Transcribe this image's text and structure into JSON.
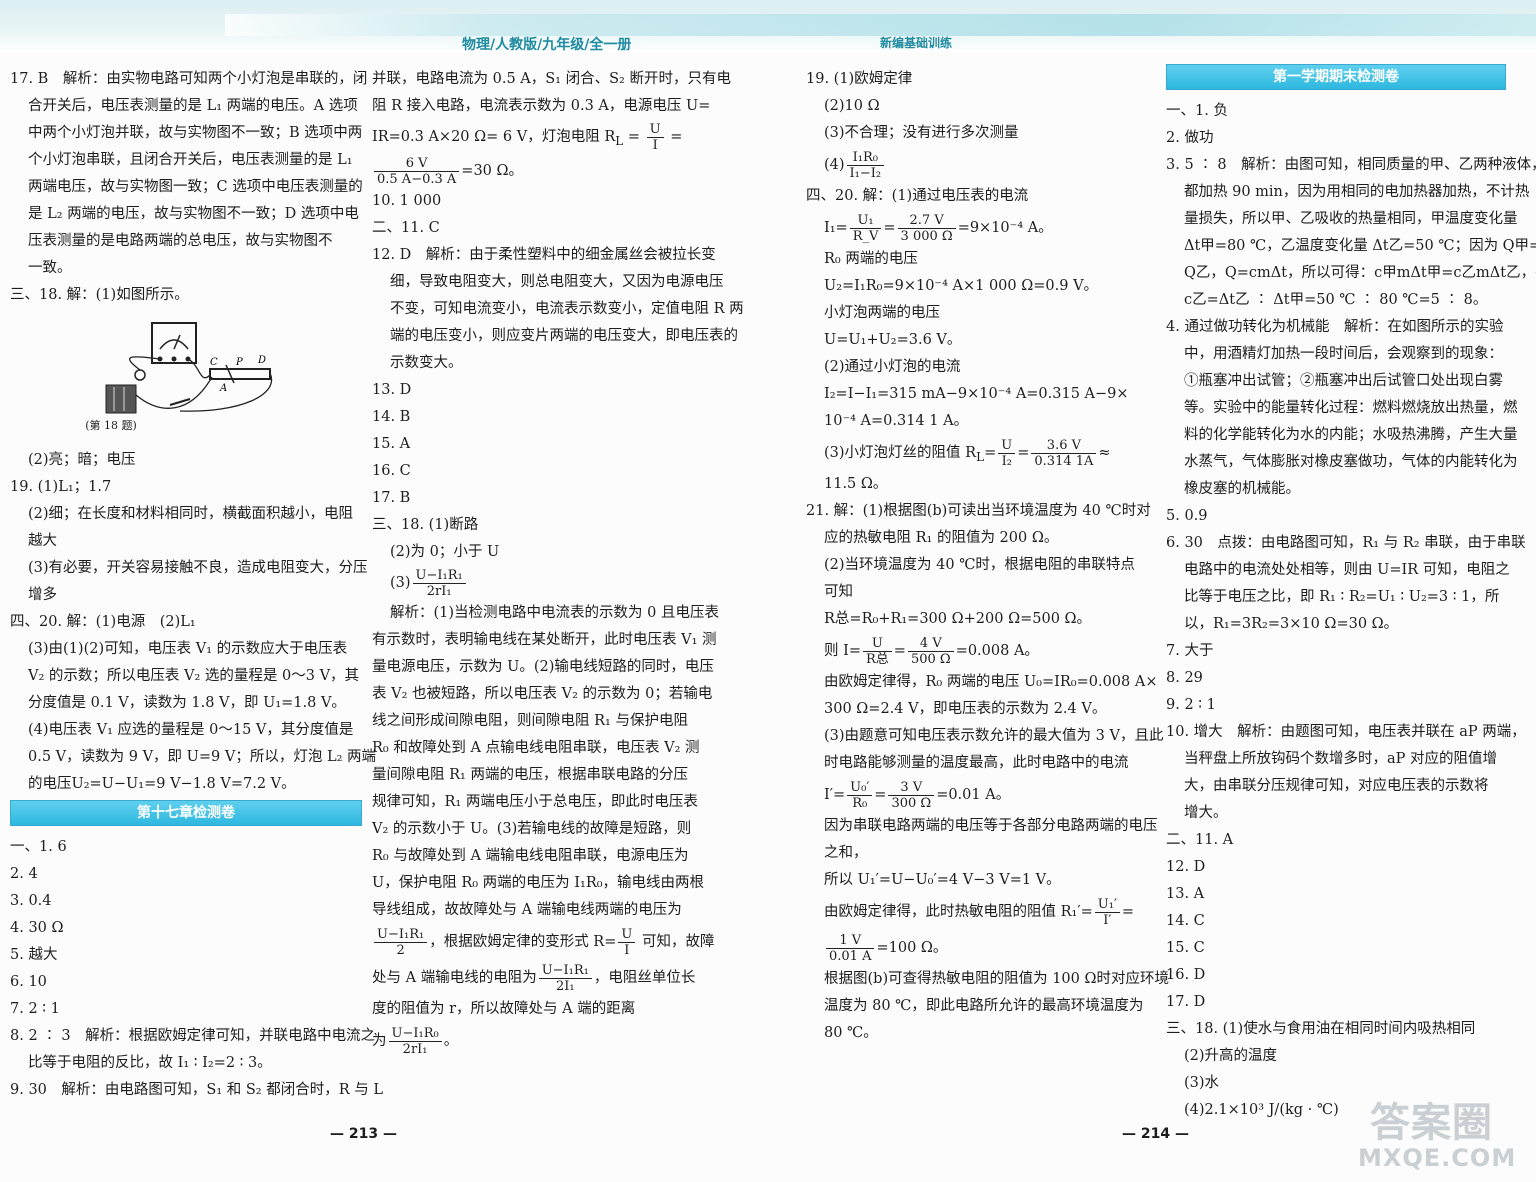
{
  "header": {
    "left": "物理/人教版/九年级/全一册",
    "right": "新编基础训练"
  },
  "col1": {
    "lines": [
      "17. B　解析：由实物电路可知两个小灯泡是串联的，闭",
      "合开关后，电压表测量的是 L₁ 两端的电压。A 选项",
      "中两个小灯泡并联，故与实物图不一致；B 选项中两",
      "个小灯泡串联，且闭合开关后，电压表测量的是 L₁",
      "两端电压，故与实物图一致；C 选项中电压表测量的",
      "是 L₂ 两端的电压，故与实物图不一致；D 选项中电",
      "压表测量的是电路两端的总电压，故与实物图不",
      "一致。",
      "三、18. 解：(1)如图所示。"
    ],
    "fig_caption": "(第 18 题)",
    "fig_labels": [
      "C",
      "P",
      "D",
      "A"
    ],
    "lines2": [
      "(2)亮；暗；电压",
      "19. (1)L₁；1.7",
      "(2)细；在长度和材料相同时，横截面积越小，电阻",
      "越大",
      "(3)有必要，开关容易接触不良，造成电阻变大，分压",
      "增多",
      "四、20. 解：(1)电源　(2)L₁",
      "(3)由(1)(2)可知，电压表 V₁ 的示数应大于电压表",
      "V₂ 的示数；所以电压表 V₂ 选的量程是 0～3 V，其",
      "分度值是 0.1 V，读数为 1.8 V，即 U₁=1.8 V。",
      "(4)电压表 V₁ 应选的量程是 0～15 V，其分度值是",
      "0.5 V，读数为 9 V，即 U=9 V；所以，灯泡 L₂ 两端",
      "的电压U₂=U−U₁=9 V−1.8 V=7.2 V。"
    ],
    "banner": "第十七章检测卷",
    "lines3": [
      "一、1. 6",
      "2. 4",
      "3. 0.4",
      "4. 30 Ω",
      "5. 越大",
      "6. 10",
      "7. 2 ∶ 1",
      "8. 2 ∶ 3　解析：根据欧姆定律可知，并联电路中电流之",
      "比等于电阻的反比，故 I₁ ∶ I₂=2 ∶ 3。",
      "9. 30　解析：由电路图可知，S₁ 和 S₂ 都闭合时，R 与 L"
    ],
    "page": "— 213 —"
  },
  "col2": {
    "l1": "并联，电路电流为 0.5 A，S₁ 闭合、S₂ 断开时，只有电",
    "l2": "阻 R 接入电路，电流表示数为 0.3 A，电源电压 U=",
    "l3a": "IR=0.3 A×20 Ω= 6 V，灯泡电阻 R",
    "l3sub": "L",
    "l3b": " =",
    "f1n": "U",
    "f1d": "I",
    "l3c": " =",
    "f2n": "6 V",
    "f2d": "0.5 A−0.3 A",
    "l4b": "=30 Ω。",
    "lines": [
      "10. 1 000",
      "二、11. C",
      "12. D　解析：由于柔性塑料中的细金属丝会被拉长变",
      "细，导致电阻变大，则总电阻变大，又因为电源电压",
      "不变，可知电流变小，电流表示数变小，定值电阻 R 两",
      "端的电压变小，则应变片两端的电压变大，即电压表的",
      "示数变大。",
      "13. D",
      "14. B",
      "15. A",
      "16. C",
      "17. B",
      "三、18. (1)断路",
      "(2)为 0；小于 U"
    ],
    "f3n": "U−I₁R₁",
    "f3d": "2rI₁",
    "lines2": [
      "解析：(1)当检测电路中电流表的示数为 0 且电压表",
      "有示数时，表明输电线在某处断开，此时电压表 V₁ 测",
      "量电源电压，示数为 U。(2)输电线短路的同时，电压",
      "表 V₂ 也被短路，所以电压表 V₂ 的示数为 0；若输电",
      "线之间形成间隙电阻，则间隙电阻 R₁ 与保护电阻",
      "R₀ 和故障处到 A 点输电线电阻串联，电压表 V₂ 测",
      "量间隙电阻 R₁ 两端的电压，根据串联电路的分压",
      "规律可知，R₁ 两端电压小于总电压，即此时电压表",
      "V₂ 的示数小于 U。(3)若输电线的故障是短路，则",
      "R₀ 与故障处到 A 端输电线电阻串联，电源电压为",
      "U，保护电阻 R₀ 两端的电压为 I₁R₀，输电线由两根",
      "导线组成，故故障处与 A 端输电线两端的电压为"
    ],
    "f4n": "U−I₁R₁",
    "f4d": "2",
    "l5a": "，根据欧姆定律的变形式 R=",
    "f5n": "U",
    "f5d": "I",
    "l5b": " 可知，故障",
    "l6a": "处与 A 端输电线的电阻为",
    "f6n": "U−I₁R₁",
    "f6d": "2I₁",
    "l6b": "，电阻丝单位长",
    "l7": "度的阻值为 r，所以故障处与 A 端的距离",
    "l8a": "为",
    "f7n": "U−I₁R₀",
    "f7d": "2rI₁",
    "l8b": "。"
  },
  "col3": {
    "lines": [
      "19. (1)欧姆定律",
      "(2)10 Ω",
      "(3)不合理；没有进行多次测量"
    ],
    "f1n": "I₁R₀",
    "f1d": "I₁−I₂",
    "l4": "(4)",
    "l5": "四、20. 解：(1)通过电压表的电流",
    "l6a": "I₁=",
    "f2n": "U₁",
    "f2d": "R_V",
    "f3n": "2.7 V",
    "f3d": "3 000 Ω",
    "l6b": "=9×10⁻⁴ A。",
    "lines2": [
      "R₀ 两端的电压",
      "U₂=I₁R₀=9×10⁻⁴ A×1 000 Ω=0.9 V。",
      "小灯泡两端的电压",
      "U=U₁+U₂=3.6 V。",
      "(2)通过小灯泡的电流",
      "I₂=I−I₁=315 mA−9×10⁻⁴ A=0.315 A−9×",
      "10⁻⁴ A=0.314 1 A。"
    ],
    "l7a": "(3)小灯泡灯丝的阻值 R",
    "l7sub": "L",
    "f4n": "U",
    "f4d": "I₂",
    "f5n": "3.6 V",
    "f5d": "0.314 1A",
    "l7b": "≈",
    "lines3": [
      "11.5 Ω。",
      "21. 解：(1)根据图(b)可读出当环境温度为 40 ℃时对",
      "应的热敏电阻 R₁ 的阻值为 200 Ω。",
      "(2)当环境温度为 40 ℃时，根据电阻的串联特点",
      "可知",
      "R总=R₀+R₁=300 Ω+200 Ω=500 Ω。"
    ],
    "l8a": "则 I=",
    "f6n": "U",
    "f6d": "R总",
    "f7n": "4 V",
    "f7d": "500 Ω",
    "l8b": "=0.008 A。",
    "lines4": [
      "由欧姆定律得，R₀ 两端的电压 U₀=IR₀=0.008 A×",
      "300 Ω=2.4 V，即电压表的示数为 2.4 V。",
      "(3)由题意可知电压表示数允许的最大值为 3 V，且此",
      "时电路能够测量的温度最高，此时电路中的电流"
    ],
    "l9a": "I′=",
    "f8n": "U₀′",
    "f8d": "R₀",
    "f9n": "3 V",
    "f9d": "300 Ω",
    "l9b": "=0.01 A。",
    "lines5": [
      "因为串联电路两端的电压等于各部分电路两端的电压",
      "之和，",
      "所以 U₁′=U−U₀′=4 V−3 V=1 V。"
    ],
    "l10a": "由欧姆定律得，此时热敏电阻的阻值 R₁′=",
    "f10n": "U₁′",
    "f10d": "I′",
    "l10b": "=",
    "f11n": "1 V",
    "f11d": "0.01 A",
    "l11b": "=100 Ω。",
    "lines6": [
      "根据图(b)可查得热敏电阻的阻值为 100 Ω时对应环境",
      "温度为 80 ℃，即此电路所允许的最高环境温度为",
      "80 ℃。"
    ]
  },
  "col4": {
    "banner": "第一学期期末检测卷",
    "lines": [
      "一、1. 负",
      "2. 做功",
      "3. 5 ∶ 8　解析：由图可知，相同质量的甲、乙两种液体，",
      "都加热 90 min，因为用相同的电加热器加热，不计热",
      "量损失，所以甲、乙吸收的热量相同，甲温度变化量",
      "Δt甲=80 ℃，乙温度变化量 Δt乙=50 ℃；因为 Q甲=",
      "Q乙，Q=cmΔt，所以可得：c甲mΔt甲=c乙mΔt乙，c甲 ∶",
      "c乙=Δt乙 ∶ Δt甲=50 ℃ ∶ 80 ℃=5 ∶ 8。",
      "4. 通过做功转化为机械能　解析：在如图所示的实验",
      "中，用酒精灯加热一段时间后，会观察到的现象：",
      "①瓶塞冲出试管；②瓶塞冲出后试管口处出现白雾",
      "等。实验中的能量转化过程：燃料燃烧放出热量，燃",
      "料的化学能转化为水的内能；水吸热沸腾，产生大量",
      "水蒸气，气体膨胀对橡皮塞做功，气体的内能转化为",
      "橡皮塞的机械能。",
      "5. 0.9",
      "6. 30　点拨：由电路图可知，R₁ 与 R₂ 串联，由于串联",
      "电路中的电流处处相等，则由 U=IR 可知，电阻之",
      "比等于电压之比，即 R₁ ∶ R₂=U₁ ∶ U₂=3 ∶ 1，所",
      "以，R₁=3R₂=3×10 Ω=30 Ω。",
      "7. 大于",
      "8. 29",
      "9. 2 ∶ 1",
      "10. 增大　解析：由题图可知，电压表并联在 aP 两端，",
      "当秤盘上所放钩码个数增多时，aP 对应的阻值增",
      "大，由串联分压规律可知，对应电压表的示数将",
      "增大。",
      "二、11. A",
      "12. D",
      "13. A",
      "14. C",
      "15. C",
      "16. D",
      "17. D",
      "三、18. (1)使水与食用油在相同时间内吸热相同",
      "(2)升高的温度",
      "(3)水",
      "(4)2.1×10³ J/(kg · ℃)"
    ],
    "page": "— 214 —"
  },
  "watermark": {
    "big": "答案圈",
    "url": "MXQE.COM"
  }
}
